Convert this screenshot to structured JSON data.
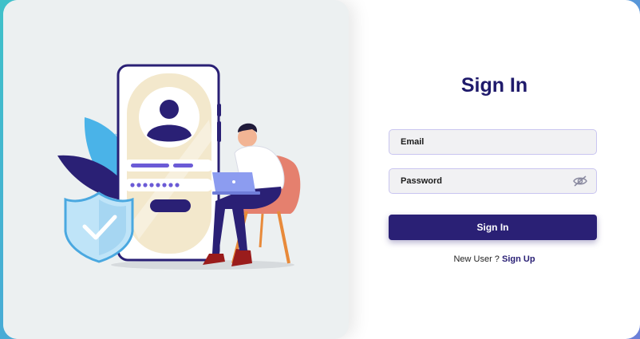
{
  "form": {
    "title": "Sign In",
    "email_placeholder": "Email",
    "password_placeholder": "Password",
    "submit_label": "Sign In",
    "new_user_text": "New User ? ",
    "signup_link_label": "Sign Up"
  },
  "icons": {
    "password_toggle": "eye-slash-icon"
  },
  "colors": {
    "accent": "#2a2075",
    "title": "#1f1a6b",
    "illustration_bg": "#ecf0f1"
  }
}
